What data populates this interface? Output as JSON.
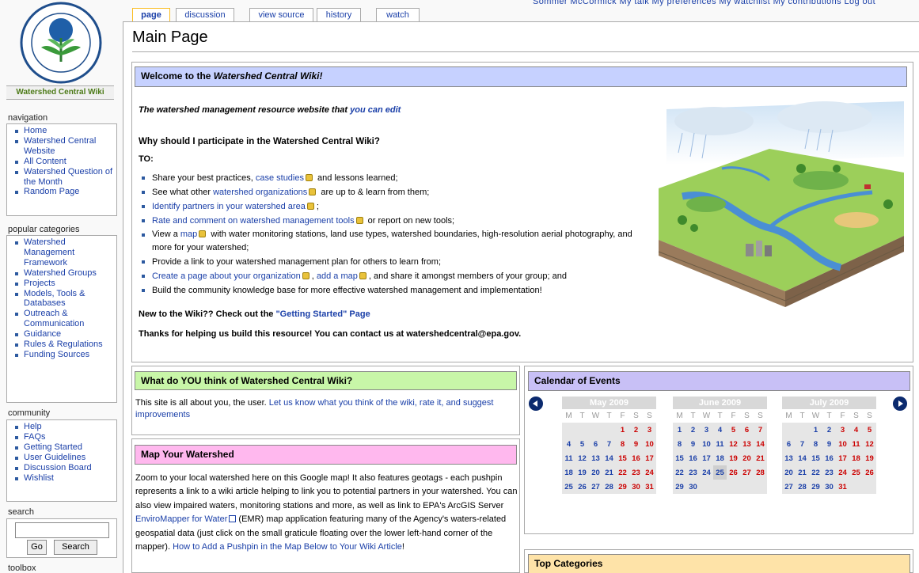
{
  "site": {
    "logo_alt": "United States Environmental Protection Agency",
    "logo_text": "UNITED STATES ENVIRONMENTAL PROTECTION AGENCY",
    "wiki_name": "Watershed Central Wiki"
  },
  "user_links": "Sommer McCormick   My talk   My preferences   My watchlist   My contributions   Log out",
  "tabs": [
    {
      "label": "page",
      "selected": true
    },
    {
      "label": "discussion"
    },
    {
      "label": "view source"
    },
    {
      "label": "history"
    },
    {
      "label": "watch"
    }
  ],
  "page_title": "Main Page",
  "sidebar": {
    "navigation": {
      "heading": "navigation",
      "items": [
        "Home",
        "Watershed Central Website",
        "All Content",
        "Watershed Question of the Month",
        "Random Page"
      ]
    },
    "popular": {
      "heading": "popular categories",
      "items": [
        "Watershed Management Framework",
        "Watershed Groups",
        "Projects",
        "Models, Tools & Databases",
        "Outreach & Communication",
        "Guidance",
        "Rules & Regulations",
        "Funding Sources"
      ]
    },
    "community": {
      "heading": "community",
      "items": [
        "Help",
        "FAQs",
        "Getting Started",
        "User Guidelines",
        "Discussion Board",
        "Wishlist"
      ]
    },
    "search": {
      "heading": "search",
      "go_label": "Go",
      "search_label": "Search",
      "placeholder": ""
    },
    "toolbox": {
      "heading": "toolbox"
    }
  },
  "welcome": {
    "header_prefix": "Welcome to the ",
    "header_em": "Watershed Central Wiki!",
    "tagline_prefix": "The watershed management resource website that ",
    "tagline_link": "you can edit",
    "why": "Why should I participate in the Watershed Central Wiki?",
    "to": "TO:",
    "bullets": [
      {
        "pre": "Share your best practices, ",
        "link": "case studies",
        "post": " and lessons learned;"
      },
      {
        "pre": "See what other ",
        "link": "watershed organizations",
        "post": " are up to & learn from them;"
      },
      {
        "pre": "",
        "link": "Identify partners in your watershed area",
        "post": ";"
      },
      {
        "pre": "",
        "link": "Rate and comment on watershed management tools",
        "post": " or report on new tools;"
      },
      {
        "pre": "View a ",
        "link": "map",
        "post": " with water monitoring stations, land use types, watershed boundaries, high-resolution aerial photography, and more for your watershed;"
      },
      {
        "pre": "Provide a link to your watershed management plan for others to learn from;",
        "link": "",
        "post": ""
      },
      {
        "pre": "",
        "link": "Create a page about your organization",
        "mid": ", ",
        "link2": "add a map",
        "post": ", and share it amongst members of your group; and"
      },
      {
        "pre": "Build the community knowledge base for more effective watershed management and implementation!",
        "link": "",
        "post": ""
      }
    ],
    "new_prefix": "New to the Wiki?? Check out the ",
    "new_link": "\"Getting Started\" Page",
    "thanks": "Thanks for helping us build this resource! You can contact us at watershedcentral@epa.gov."
  },
  "feedback": {
    "header": "What do YOU think of Watershed Central Wiki?",
    "pre": "This site is all about you, the user. ",
    "link": "Let us know what you think of the wiki, rate it, and suggest improvements"
  },
  "map": {
    "header": "Map Your Watershed",
    "text1": "Zoom to your local watershed here on this Google map! It also features geotags - each pushpin represents a link to a wiki article helping to link you to potential partners in your watershed. You can also view impaired waters, monitoring stations and more, as well as link to EPA's ArcGIS Server ",
    "link1": "EnviroMapper for Water",
    "text2": " (EMR) map application featuring many of the Agency's waters-related geospatial data (just click on the small graticule floating over the lower left-hand corner of the mapper). ",
    "link2": "How to Add a Pushpin in the Map Below to Your Wiki Article",
    "text3": "!"
  },
  "calendar": {
    "header": "Calendar of Events",
    "weekday_header": [
      "M",
      "T",
      "W",
      "T",
      "F",
      "S",
      "S"
    ],
    "months": [
      {
        "name": "May 2009",
        "lead": 4,
        "days": 31
      },
      {
        "name": "June 2009",
        "lead": 0,
        "days": 30,
        "today": 25
      },
      {
        "name": "July 2009",
        "lead": 2,
        "days": 31
      }
    ]
  },
  "top_categories": {
    "header": "Top Categories"
  },
  "colors": {
    "welcome_bg": "#c6d1ff",
    "feedback_bg": "#c8f6a8",
    "map_bg": "#ffb8ee",
    "calendar_bg": "#c8c0f6",
    "topcat_bg": "#fee3a8",
    "tab_selected_border": "#fabd23",
    "link": "#1a3fa8",
    "weekend": "#cc0000"
  }
}
